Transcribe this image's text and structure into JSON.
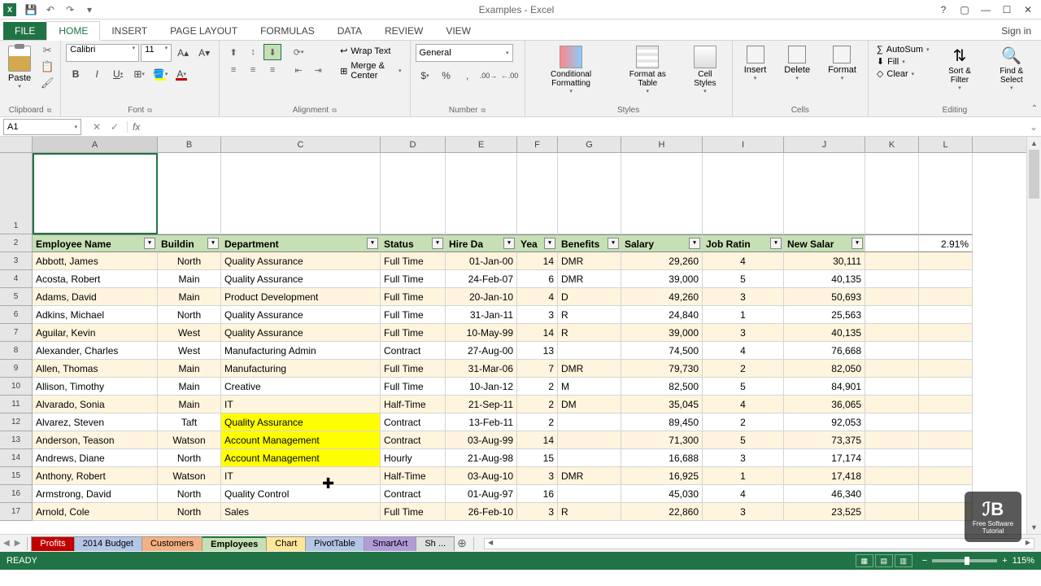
{
  "title": "Examples - Excel",
  "signin": "Sign in",
  "qat": {
    "save": "💾",
    "undo": "↶",
    "redo": "↷",
    "customize": "▾"
  },
  "tabs": [
    "FILE",
    "HOME",
    "INSERT",
    "PAGE LAYOUT",
    "FORMULAS",
    "DATA",
    "REVIEW",
    "VIEW"
  ],
  "activeTab": "HOME",
  "ribbon": {
    "clipboard": {
      "label": "Clipboard",
      "paste": "Paste",
      "cut": "✂",
      "copy": "📋",
      "painter": "🖌"
    },
    "font": {
      "label": "Font",
      "name": "Calibri",
      "size": "11",
      "grow": "A▴",
      "shrink": "A▾",
      "bold": "B",
      "italic": "I",
      "underline": "U"
    },
    "alignment": {
      "label": "Alignment",
      "wrap": "Wrap Text",
      "merge": "Merge & Center"
    },
    "number": {
      "label": "Number",
      "format": "General",
      "currency": "$",
      "percent": "%",
      "comma": ",",
      "inc": ".00→",
      "dec": "←.00"
    },
    "styles": {
      "label": "Styles",
      "cond": "Conditional Formatting",
      "table": "Format as Table",
      "cell": "Cell Styles"
    },
    "cells": {
      "label": "Cells",
      "insert": "Insert",
      "delete": "Delete",
      "format": "Format"
    },
    "editing": {
      "label": "Editing",
      "sum": "AutoSum",
      "fill": "Fill",
      "clear": "Clear",
      "sort": "Sort & Filter",
      "find": "Find & Select"
    }
  },
  "nameBox": "A1",
  "formulaValue": "",
  "columns": [
    "A",
    "B",
    "C",
    "D",
    "E",
    "F",
    "G",
    "H",
    "I",
    "J",
    "K",
    "L"
  ],
  "headers": [
    "Employee Name",
    "Buildin",
    "Department",
    "Status",
    "Hire Da",
    "Yea",
    "Benefits",
    "Salary",
    "Job Ratin",
    "New Salar"
  ],
  "extraCell": "2.91%",
  "rows": [
    {
      "n": 3,
      "d": [
        "Abbott, James",
        "North",
        "Quality Assurance",
        "Full Time",
        "01-Jan-00",
        "14",
        "DMR",
        "29,260",
        "4",
        "30,111"
      ]
    },
    {
      "n": 4,
      "d": [
        "Acosta, Robert",
        "Main",
        "Quality Assurance",
        "Full Time",
        "24-Feb-07",
        "6",
        "DMR",
        "39,000",
        "5",
        "40,135"
      ]
    },
    {
      "n": 5,
      "d": [
        "Adams, David",
        "Main",
        "Product Development",
        "Full Time",
        "20-Jan-10",
        "4",
        "D",
        "49,260",
        "3",
        "50,693"
      ]
    },
    {
      "n": 6,
      "d": [
        "Adkins, Michael",
        "North",
        "Quality Assurance",
        "Full Time",
        "31-Jan-11",
        "3",
        "R",
        "24,840",
        "1",
        "25,563"
      ]
    },
    {
      "n": 7,
      "d": [
        "Aguilar, Kevin",
        "West",
        "Quality Assurance",
        "Full Time",
        "10-May-99",
        "14",
        "R",
        "39,000",
        "3",
        "40,135"
      ]
    },
    {
      "n": 8,
      "d": [
        "Alexander, Charles",
        "West",
        "Manufacturing Admin",
        "Contract",
        "27-Aug-00",
        "13",
        "",
        "74,500",
        "4",
        "76,668"
      ]
    },
    {
      "n": 9,
      "d": [
        "Allen, Thomas",
        "Main",
        "Manufacturing",
        "Full Time",
        "31-Mar-06",
        "7",
        "DMR",
        "79,730",
        "2",
        "82,050"
      ]
    },
    {
      "n": 10,
      "d": [
        "Allison, Timothy",
        "Main",
        "Creative",
        "Full Time",
        "10-Jan-12",
        "2",
        "M",
        "82,500",
        "5",
        "84,901"
      ]
    },
    {
      "n": 11,
      "d": [
        "Alvarado, Sonia",
        "Main",
        "IT",
        "Half-Time",
        "21-Sep-11",
        "2",
        "DM",
        "35,045",
        "4",
        "36,065"
      ]
    },
    {
      "n": 12,
      "d": [
        "Alvarez, Steven",
        "Taft",
        "Quality Assurance",
        "Contract",
        "13-Feb-11",
        "2",
        "",
        "89,450",
        "2",
        "92,053"
      ]
    },
    {
      "n": 13,
      "d": [
        "Anderson, Teason",
        "Watson",
        "Account Management",
        "Contract",
        "03-Aug-99",
        "14",
        "",
        "71,300",
        "5",
        "73,375"
      ]
    },
    {
      "n": 14,
      "d": [
        "Andrews, Diane",
        "North",
        "Account Management",
        "Hourly",
        "21-Aug-98",
        "15",
        "",
        "16,688",
        "3",
        "17,174"
      ]
    },
    {
      "n": 15,
      "d": [
        "Anthony, Robert",
        "Watson",
        "IT",
        "Half-Time",
        "03-Aug-10",
        "3",
        "DMR",
        "16,925",
        "1",
        "17,418"
      ]
    },
    {
      "n": 16,
      "d": [
        "Armstrong, David",
        "North",
        "Quality Control",
        "Contract",
        "01-Aug-97",
        "16",
        "",
        "45,030",
        "4",
        "46,340"
      ]
    },
    {
      "n": 17,
      "d": [
        "Arnold, Cole",
        "North",
        "Sales",
        "Full Time",
        "26-Feb-10",
        "3",
        "R",
        "22,860",
        "3",
        "23,525"
      ]
    }
  ],
  "worksheets": [
    {
      "name": "Profits",
      "cls": "red"
    },
    {
      "name": "2014 Budget",
      "cls": "blue"
    },
    {
      "name": "Customers",
      "cls": "orange"
    },
    {
      "name": "Employees",
      "cls": "green"
    },
    {
      "name": "Chart",
      "cls": "yellow"
    },
    {
      "name": "PivotTable",
      "cls": "blue"
    },
    {
      "name": "SmartArt",
      "cls": "purple"
    },
    {
      "name": "Sh ...",
      "cls": "gray"
    }
  ],
  "status": "READY",
  "zoom": "115%",
  "watermark": {
    "logo": "ℐB",
    "text": "Free Software Tutorial"
  }
}
